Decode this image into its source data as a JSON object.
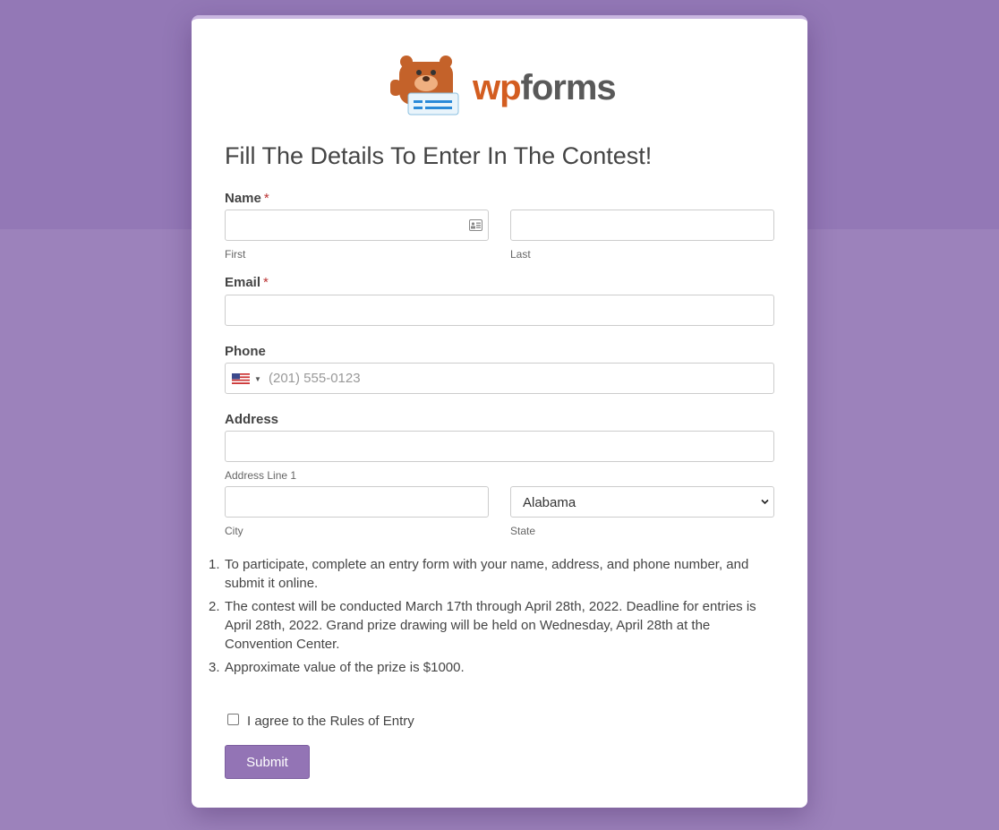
{
  "logo": {
    "text_wp": "wp",
    "text_forms": "forms"
  },
  "form": {
    "title": "Fill The Details To Enter In The Contest!",
    "name": {
      "label": "Name",
      "required": "*",
      "first_sublabel": "First",
      "last_sublabel": "Last"
    },
    "email": {
      "label": "Email",
      "required": "*"
    },
    "phone": {
      "label": "Phone",
      "placeholder": "(201) 555-0123",
      "country": "US"
    },
    "address": {
      "label": "Address",
      "line1_sublabel": "Address Line 1",
      "city_sublabel": "City",
      "state_sublabel": "State",
      "state_value": "Alabama"
    },
    "rules": [
      {
        "num": "1.",
        "text": "To participate, complete an entry form with your name, address, and phone number, and submit it online."
      },
      {
        "num": "2.",
        "text": "The contest will be conducted March 17th through April 28th, 2022. Deadline for entries is April 28th, 2022. Grand prize drawing will be held on Wednesday, April 28th at the Convention Center."
      },
      {
        "num": "3.",
        "text": "Approximate value of the prize is $1000."
      }
    ],
    "agree_label": "I agree to the Rules of Entry",
    "submit_label": "Submit"
  },
  "colors": {
    "accent": "#9374b5",
    "background": "#9c82bb",
    "required": "#bb3333"
  }
}
